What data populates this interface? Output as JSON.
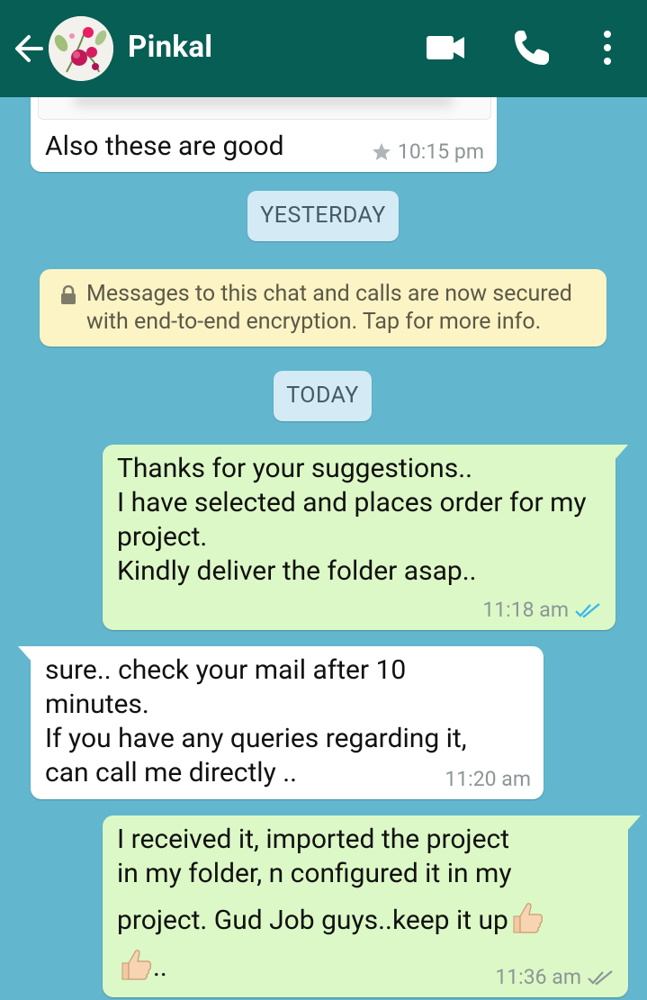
{
  "header": {
    "contact_name": "Pinkal",
    "icons": [
      "back-arrow-icon",
      "video-call-icon",
      "phone-call-icon",
      "more-options-icon"
    ]
  },
  "messages": [
    {
      "direction": "in",
      "text": "Also these are good",
      "time": "10:15 pm",
      "starred": true
    },
    {
      "direction": "out",
      "text": "Thanks for your suggestions..\nI have selected and places order for my project.\nKindly deliver the folder asap..",
      "time": "11:18 am",
      "status": "read"
    },
    {
      "direction": "in",
      "text": "sure.. check your mail after 10 minutes.\nIf you have any queries regarding it, can call me directly ..",
      "time": "11:20 am"
    },
    {
      "direction": "out",
      "text_line1": "I received it, imported the project",
      "text_line2": "in my folder, n configured it in my",
      "text_line3": "project. Gud Job guys..keep it up",
      "text_line4": "..",
      "emoji": "thumbs-up",
      "time": "11:36 am",
      "status": "delivered"
    }
  ],
  "date_labels": {
    "yesterday": "YESTERDAY",
    "today": "TODAY"
  },
  "encryption_notice": "Messages to this chat and calls are now secured with end-to-end encryption. Tap for more info.",
  "colors": {
    "header": "#075e54",
    "background": "#62b7cf",
    "outgoing": "#dcf8c6",
    "incoming": "#ffffff",
    "read_ticks": "#34b7f1",
    "notice": "#fdf4c5",
    "date_pill": "#d4eaf4"
  }
}
